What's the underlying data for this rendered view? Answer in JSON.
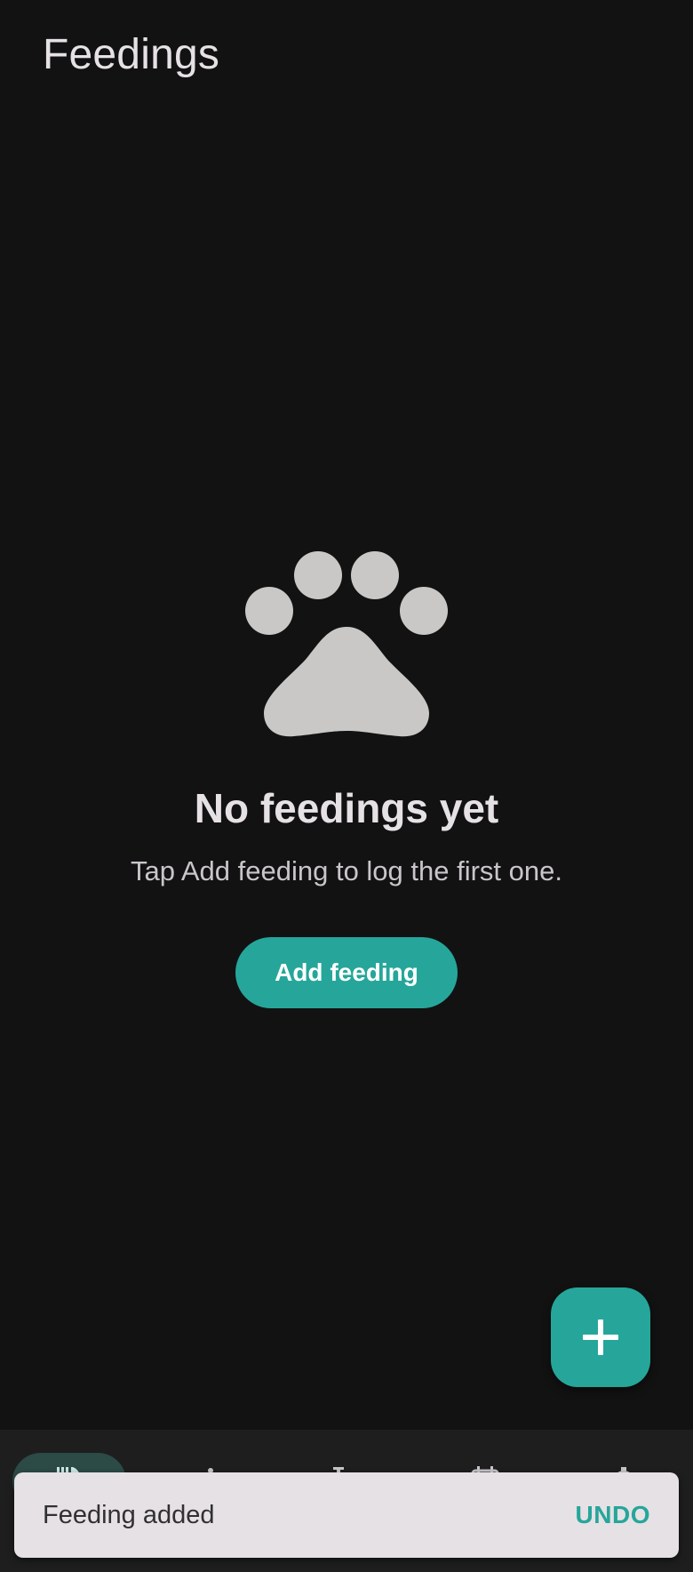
{
  "header": {
    "title": "Feedings"
  },
  "empty_state": {
    "icon": "paw-icon",
    "title": "No feedings yet",
    "subtitle": "Tap Add feeding to log the first one.",
    "button_label": "Add feeding"
  },
  "fab": {
    "icon": "plus-icon"
  },
  "bottom_nav": {
    "items": [
      {
        "icon": "feedings-icon",
        "active": true
      },
      {
        "icon": "info-icon",
        "active": false
      },
      {
        "icon": "weight-icon",
        "active": false
      },
      {
        "icon": "calendar-icon",
        "active": false
      },
      {
        "icon": "settings-icon",
        "active": false
      }
    ]
  },
  "snackbar": {
    "message": "Feeding added",
    "action_label": "UNDO"
  },
  "colors": {
    "background": "#121212",
    "accent": "#26a69a",
    "on_surface": "#e6e1e5",
    "icon_gray": "#c9c8c6",
    "snackbar_bg": "#e6e1e5"
  }
}
